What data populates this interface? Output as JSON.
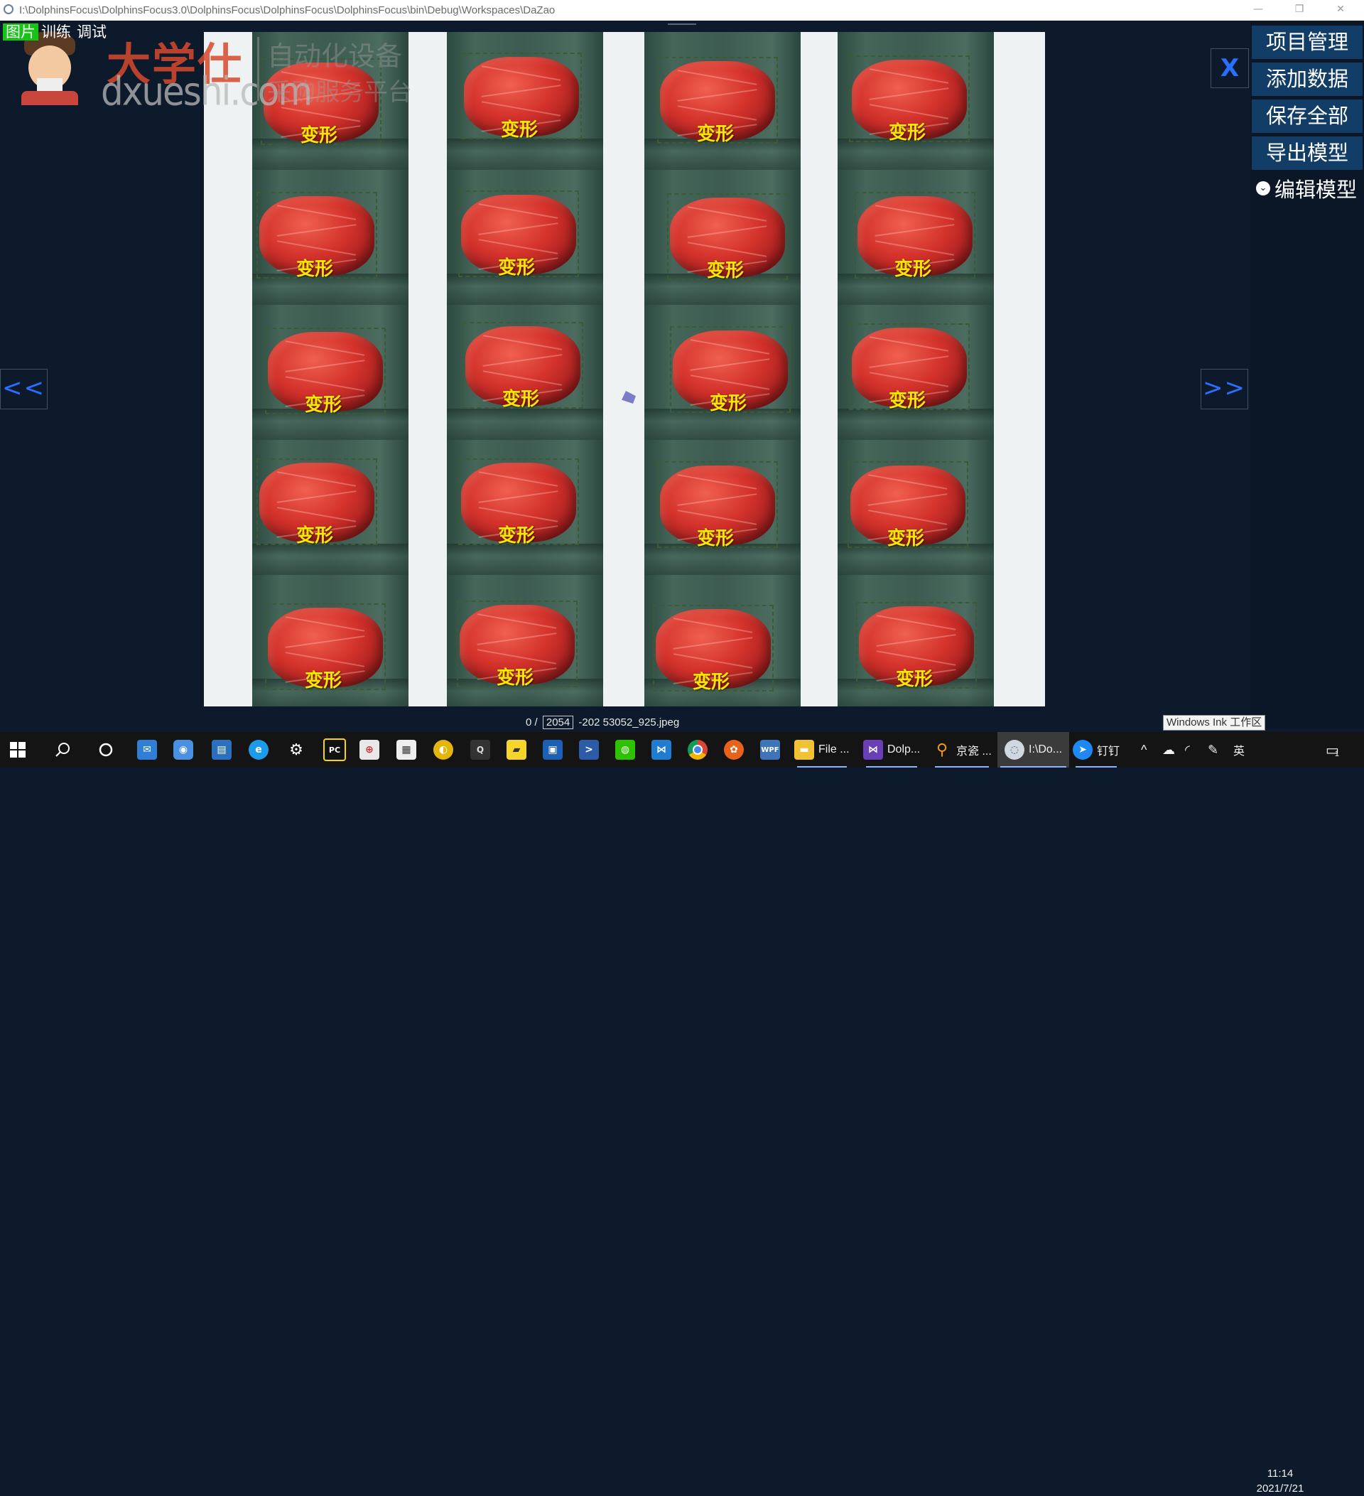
{
  "window": {
    "title": "I:\\DolphinsFocus\\DolphinsFocus3.0\\DolphinsFocus\\DolphinsFocus\\DolphinsFocus\\bin\\Debug\\Workspaces\\DaZao",
    "minimize": "—",
    "restore": "❐",
    "close": "✕"
  },
  "mode_tabs": [
    {
      "label": "图片",
      "active": true
    },
    {
      "label": "训练",
      "active": false
    },
    {
      "label": "调试",
      "active": false
    }
  ],
  "watermark": {
    "name_cn": "大学仕",
    "domain": "dxueshi.com",
    "line1": "自动化设备",
    "line2": "采购服务平台"
  },
  "detections": {
    "label": "变形",
    "columns": 4,
    "rows": 5
  },
  "nav": {
    "prev": "<<",
    "next": ">>",
    "close": "X"
  },
  "status": {
    "index": "0",
    "sep": "/",
    "total": "2054",
    "filename": "-202   53052_925.jpeg"
  },
  "side_panel": {
    "buttons": [
      "项目管理",
      "添加数据",
      "保存全部",
      "导出模型"
    ],
    "toggle_label": "编辑模型"
  },
  "ink_tooltip": "Windows Ink 工作区",
  "taskbar": {
    "apps": [
      {
        "icon": "file-explorer-icon",
        "label": "File ..."
      },
      {
        "icon": "visual-studio-icon",
        "label": "Dolp..."
      },
      {
        "icon": "search-app-icon",
        "label": "京瓷 ..."
      },
      {
        "icon": "dolphins-app-icon",
        "label": "I:\\Do..."
      },
      {
        "icon": "dingtalk-icon",
        "label": "钉钉"
      }
    ],
    "ime": "英",
    "time": "11:14",
    "date": "2021/7/21",
    "notifications": "1"
  },
  "colors": {
    "background": "#0d1a2b",
    "side_button": "#123d66",
    "accent_blue": "#2a6fff",
    "label_yellow": "#ffe600",
    "active_tab": "#15c415"
  }
}
